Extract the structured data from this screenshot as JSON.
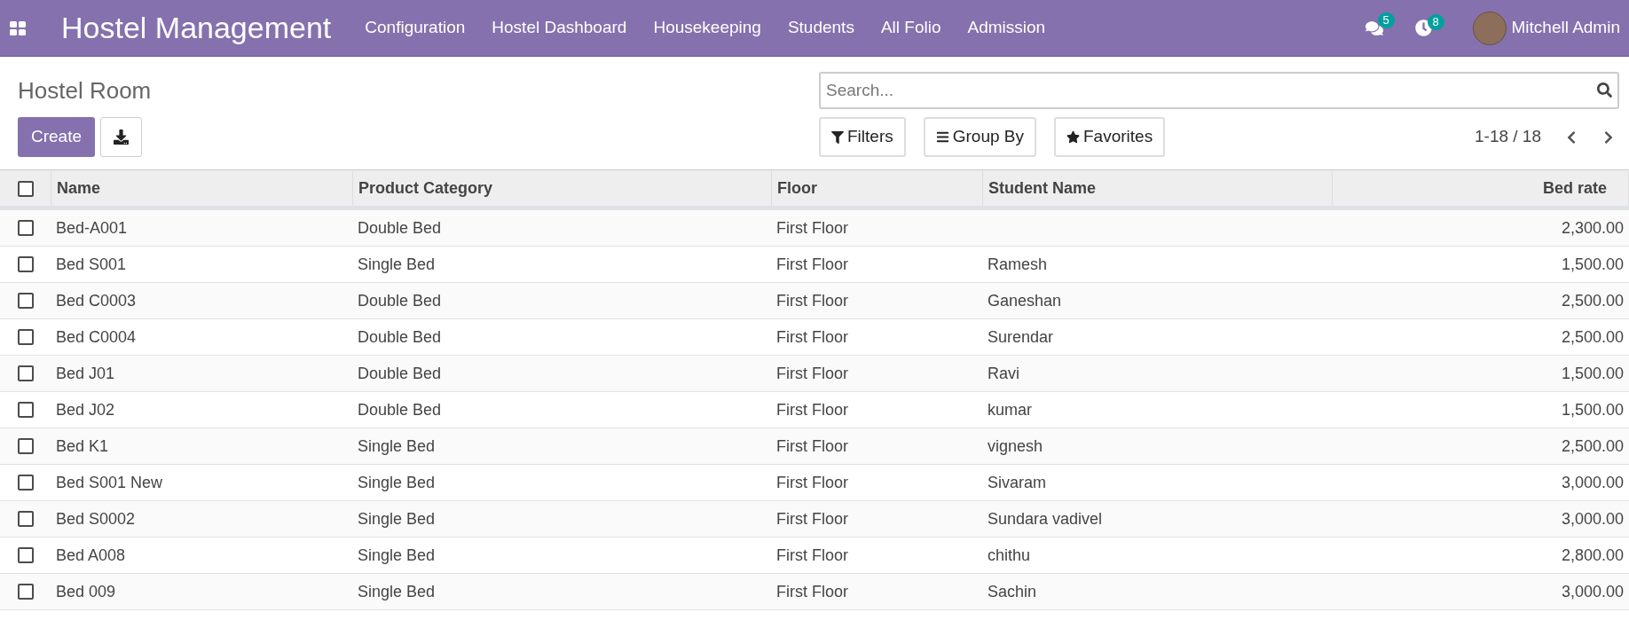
{
  "navbar": {
    "app_title": "Hostel Management",
    "menu": [
      "Configuration",
      "Hostel Dashboard",
      "Housekeeping",
      "Students",
      "All Folio",
      "Admission"
    ],
    "messages_badge": "5",
    "activities_badge": "8",
    "user": "Mitchell Admin"
  },
  "control_panel": {
    "breadcrumb": "Hostel Room",
    "create_button": "Create",
    "search": {
      "placeholder": "Search..."
    },
    "filters": "Filters",
    "group_by": "Group By",
    "favorites": "Favorites",
    "pager": "1-18 / 18"
  },
  "table": {
    "select_all_checked": false,
    "columns": [
      "Name",
      "Product Category",
      "Floor",
      "Student Name",
      "Bed rate"
    ],
    "rows": [
      {
        "checked": false,
        "cells": [
          "Bed-A001",
          "Double Bed",
          "First Floor",
          "",
          "2,300.00"
        ]
      },
      {
        "checked": false,
        "cells": [
          "Bed S001",
          "Single Bed",
          "First Floor",
          "Ramesh",
          "1,500.00"
        ]
      },
      {
        "checked": false,
        "cells": [
          "Bed C0003",
          "Double Bed",
          "First Floor",
          "Ganeshan",
          "2,500.00"
        ]
      },
      {
        "checked": false,
        "cells": [
          "Bed C0004",
          "Double Bed",
          "First Floor",
          "Surendar",
          "2,500.00"
        ]
      },
      {
        "checked": false,
        "cells": [
          "Bed J01",
          "Double Bed",
          "First Floor",
          "Ravi",
          "1,500.00"
        ]
      },
      {
        "checked": false,
        "cells": [
          "Bed J02",
          "Double Bed",
          "First Floor",
          "kumar",
          "1,500.00"
        ]
      },
      {
        "checked": false,
        "cells": [
          "Bed K1",
          "Single Bed",
          "First Floor",
          "vignesh",
          "2,500.00"
        ]
      },
      {
        "checked": false,
        "cells": [
          "Bed S001 New",
          "Single Bed",
          "First Floor",
          "Sivaram",
          "3,000.00"
        ]
      },
      {
        "checked": false,
        "cells": [
          "Bed S0002",
          "Single Bed",
          "First Floor",
          "Sundara vadivel",
          "3,000.00"
        ]
      },
      {
        "checked": false,
        "cells": [
          "Bed A008",
          "Single Bed",
          "First Floor",
          "chithu",
          "2,800.00"
        ]
      },
      {
        "checked": false,
        "cells": [
          "Bed 009",
          "Single Bed",
          "First Floor",
          "Sachin",
          "3,000.00"
        ]
      }
    ]
  }
}
